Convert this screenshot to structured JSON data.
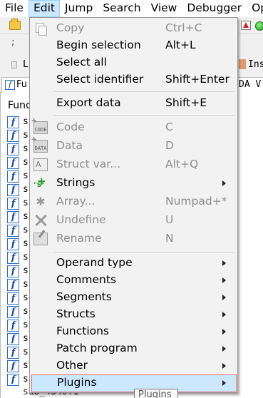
{
  "menubar": {
    "items": [
      "File",
      "Edit",
      "Jump",
      "Search",
      "View",
      "Debugger",
      "Op"
    ]
  },
  "band": {
    "semi": ";"
  },
  "nav": {
    "left_label": "L",
    "right_label": "Ins"
  },
  "tabs": {
    "functions": "Fu",
    "ida_view": "DA V"
  },
  "functions_pane": {
    "header": "Func",
    "row_text": "s",
    "last_row": "sub_4340f1",
    "icon_glyph": "f"
  },
  "edit_menu": {
    "items": [
      {
        "label": "Copy",
        "shortcut": "Ctrl+C",
        "enabled": false,
        "icon": "copy-icon"
      },
      {
        "label": "Begin selection",
        "shortcut": "Alt+L",
        "enabled": true
      },
      {
        "label": "Select all",
        "shortcut": "",
        "enabled": true
      },
      {
        "label": "Select identifier",
        "shortcut": "Shift+Enter",
        "enabled": true
      },
      {
        "label": "Export data",
        "shortcut": "Shift+E",
        "enabled": true
      },
      {
        "label": "Code",
        "shortcut": "C",
        "enabled": false,
        "icon": "code-icon",
        "icon_text": "CODE"
      },
      {
        "label": "Data",
        "shortcut": "D",
        "enabled": false,
        "icon": "data-icon",
        "icon_text": "DATA"
      },
      {
        "label": "Struct var...",
        "shortcut": "Alt+Q",
        "enabled": false,
        "icon": "struct-icon",
        "icon_text": "A"
      },
      {
        "label": "Strings",
        "shortcut": "",
        "enabled": true,
        "submenu": true,
        "icon": "strings-icon"
      },
      {
        "label": "Array...",
        "shortcut": "Numpad+*",
        "enabled": false,
        "icon": "array-icon",
        "icon_text": "✱"
      },
      {
        "label": "Undefine",
        "shortcut": "U",
        "enabled": false,
        "icon": "undefine-icon"
      },
      {
        "label": "Rename",
        "shortcut": "N",
        "enabled": false,
        "icon": "rename-icon"
      },
      {
        "label": "Operand type",
        "submenu": true,
        "enabled": true
      },
      {
        "label": "Comments",
        "submenu": true,
        "enabled": true
      },
      {
        "label": "Segments",
        "submenu": true,
        "enabled": true
      },
      {
        "label": "Structs",
        "submenu": true,
        "enabled": true
      },
      {
        "label": "Functions",
        "submenu": true,
        "enabled": true
      },
      {
        "label": "Patch program",
        "submenu": true,
        "enabled": true
      },
      {
        "label": "Other",
        "submenu": true,
        "enabled": true
      },
      {
        "label": "Plugins",
        "submenu": true,
        "enabled": true,
        "highlighted": true
      }
    ]
  },
  "tooltip": {
    "text": "Plugins"
  },
  "colors": {
    "menu_highlight": "#cce8ff",
    "highlight_border": "#e06f6f",
    "disabled_text": "#8d8d8d",
    "function_icon": "#2a6fc9"
  }
}
